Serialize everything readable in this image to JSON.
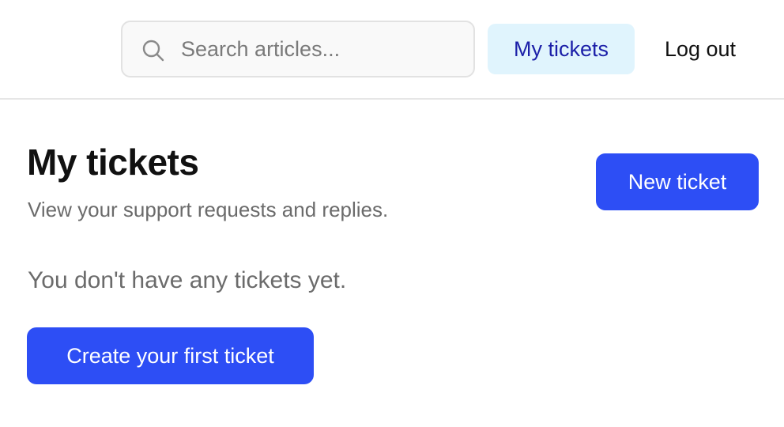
{
  "header": {
    "search": {
      "placeholder": "Search articles...",
      "value": "",
      "icon": "search-icon"
    },
    "nav": {
      "my_tickets_label": "My tickets",
      "logout_label": "Log out"
    }
  },
  "main": {
    "title": "My tickets",
    "subtitle": "View your support requests and replies.",
    "new_ticket_label": "New ticket",
    "empty_state": {
      "message": "You don't have any tickets yet.",
      "cta_label": "Create your first ticket"
    }
  },
  "colors": {
    "primary": "#2d4ef5",
    "nav_active_bg": "#e0f4fd",
    "nav_active_text": "#1b1fa8",
    "muted_text": "#6b6b6b",
    "divider": "#e6e6e6"
  }
}
